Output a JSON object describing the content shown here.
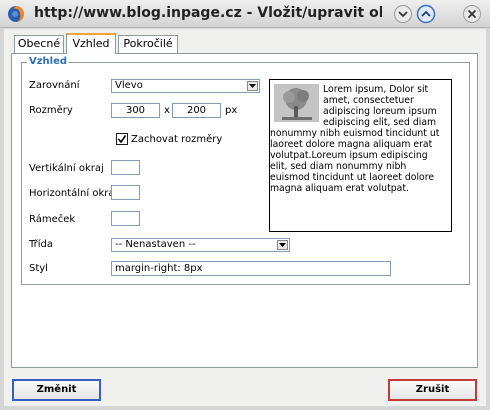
{
  "window": {
    "title": "http://www.blog.inpage.cz - Vložit/upravit obrázek",
    "icons": [
      "firefox-icon",
      "minimize-icon",
      "maximize-icon",
      "close-icon"
    ]
  },
  "tabs": [
    {
      "label": "Obecné",
      "active": false
    },
    {
      "label": "Vzhled",
      "active": true
    },
    {
      "label": "Pokročilé",
      "active": false
    }
  ],
  "appearance": {
    "legend": "Vzhled",
    "align_label": "Zarovnání",
    "align_value": "Vlevo",
    "dimensions_label": "Rozměry",
    "width": "300",
    "times": "x",
    "height": "200",
    "unit": "px",
    "keep_ratio_label": "Zachovat rozměry",
    "keep_ratio_checked": true,
    "vspace_label": "Vertikální okraj",
    "vspace_value": "",
    "hspace_label": "Horizontální okraj",
    "hspace_value": "",
    "border_label": "Rámeček",
    "border_value": "",
    "class_label": "Třída",
    "class_value": "-- Nenastaven --",
    "style_label": "Styl",
    "style_value": "margin-right: 8px"
  },
  "preview_text": "Lorem ipsum, Dolor sit amet, consectetuer adipiscing loreum ipsum edipiscing elit, sed diam nonummy nibh euismod tincidunt ut laoreet dolore magna aliquam erat volutpat.Loreum ipsum edipiscing elit, sed diam nonummy nibh euismod tincidunt ut laoreet dolore magna aliquam erat volutpat.",
  "buttons": {
    "submit": "Změnit",
    "cancel": "Zrušit"
  },
  "colors": {
    "accent_tab": "#f0a33c",
    "legend": "#2b6fb6",
    "submit_border": "#3a5ec0",
    "cancel_border": "#c23b3b"
  }
}
